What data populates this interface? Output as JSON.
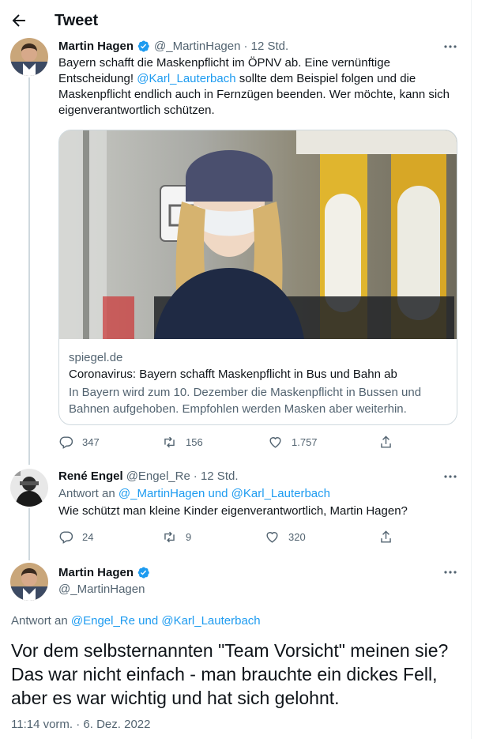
{
  "header": {
    "title": "Tweet"
  },
  "tweet1": {
    "author_name": "Martin Hagen",
    "author_handle": "@_MartinHagen",
    "time": "· 12 Std.",
    "text_line1": "Bayern schafft die Maskenpflicht im ÖPNV ab. Eine  vernünftige",
    "text_line2_prefix": "Entscheidung! ",
    "text_line2_mention": "@Karl_Lauterbach",
    "text_line2_suffix": " sollte dem Beispiel folgen und die",
    "text_line3": "Maskenpflicht endlich auch in Fernzügen beenden. Wer möchte, kann sich",
    "text_line4": "eigenverantwortlich schützen.",
    "card": {
      "domain": "spiegel.de",
      "title": "Coronavirus: Bayern schafft Maskenpflicht in Bus und Bahn ab",
      "description": "In Bayern wird zum 10. Dezember die Maskenpflicht in Bussen und Bahnen aufgehoben. Empfohlen werden Masken aber weiterhin."
    },
    "actions": {
      "replies": "347",
      "retweets": "156",
      "likes": "1.757"
    }
  },
  "tweet2": {
    "author_name": "René Engel",
    "author_handle": "@Engel_Re",
    "time": "· 12 Std.",
    "reply_prefix": "Antwort an ",
    "reply_mentions": "@_MartinHagen und @Karl_Lauterbach",
    "text": "Wie schützt man kleine Kinder eigenverantwortlich, Martin Hagen?",
    "actions": {
      "replies": "24",
      "retweets": "9",
      "likes": "320"
    }
  },
  "focus": {
    "author_name": "Martin Hagen",
    "author_handle": "@_MartinHagen",
    "reply_prefix": "Antwort an ",
    "reply_mentions": "@Engel_Re und @Karl_Lauterbach",
    "text": "Vor dem selbsternannten \"Team Vorsicht\" meinen sie? Das war nicht einfach - man brauchte ein dickes Fell, aber es war wichtig und hat sich gelohnt.",
    "timestamp": "11:14 vorm. · 6. Dez. 2022"
  },
  "colors": {
    "accent": "#1d9bf0",
    "secondary_text": "#536471",
    "border": "#cfd9de"
  },
  "icons": [
    "back-arrow-icon",
    "verified-badge-icon",
    "more-icon",
    "reply-icon",
    "retweet-icon",
    "like-icon",
    "share-icon"
  ]
}
